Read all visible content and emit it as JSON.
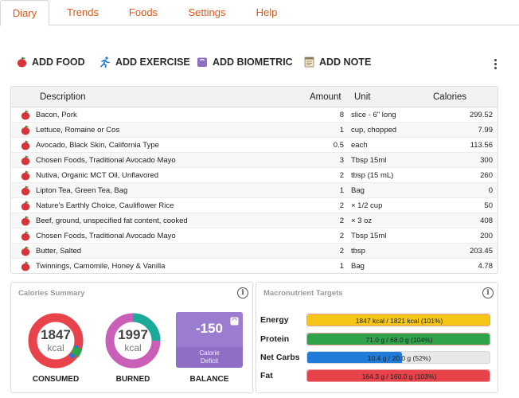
{
  "tabs": [
    {
      "label": "Diary",
      "active": true
    },
    {
      "label": "Trends"
    },
    {
      "label": "Foods"
    },
    {
      "label": "Settings"
    },
    {
      "label": "Help"
    }
  ],
  "actions": {
    "add_food": "ADD FOOD",
    "add_exercise": "ADD EXERCISE",
    "add_biometric": "ADD BIOMETRIC",
    "add_note": "ADD NOTE"
  },
  "table": {
    "headers": {
      "description": "Description",
      "amount": "Amount",
      "unit": "Unit",
      "calories": "Calories"
    },
    "rows": [
      {
        "description": "Bacon, Pork",
        "amount": "8",
        "unit": "slice - 6\" long",
        "calories": "299.52"
      },
      {
        "description": "Lettuce, Romaine or Cos",
        "amount": "1",
        "unit": "cup, chopped",
        "calories": "7.99"
      },
      {
        "description": "Avocado, Black Skin, California Type",
        "amount": "0.5",
        "unit": "each",
        "calories": "113.56"
      },
      {
        "description": "Chosen Foods, Traditional Avocado Mayo",
        "amount": "3",
        "unit": "Tbsp 15ml",
        "calories": "300"
      },
      {
        "description": "Nutiva, Organic MCT Oil, Unflavored",
        "amount": "2",
        "unit": "tbsp (15 mL)",
        "calories": "260"
      },
      {
        "description": "Lipton Tea, Green Tea, Bag",
        "amount": "1",
        "unit": "Bag",
        "calories": "0"
      },
      {
        "description": "Nature's Earthly Choice, Cauliflower Rice",
        "amount": "2",
        "unit": "× 1/2 cup",
        "calories": "50"
      },
      {
        "description": "Beef, ground, unspecified fat content, cooked",
        "amount": "2",
        "unit": "× 3 oz",
        "calories": "408"
      },
      {
        "description": "Chosen Foods, Traditional Avocado Mayo",
        "amount": "2",
        "unit": "Tbsp 15ml",
        "calories": "200"
      },
      {
        "description": "Butter, Salted",
        "amount": "2",
        "unit": "tbsp",
        "calories": "203.45"
      },
      {
        "description": "Twinnings, Camomile, Honey & Vanilla",
        "amount": "1",
        "unit": "Bag",
        "calories": "4.78"
      }
    ]
  },
  "calories_summary": {
    "title": "Calories Summary",
    "consumed": {
      "value": "1847",
      "unit": "kcal",
      "label": "CONSUMED"
    },
    "burned": {
      "value": "1997",
      "unit": "kcal",
      "label": "BURNED"
    },
    "balance": {
      "value": "-150",
      "sub1": "Calorie",
      "sub2": "Deficit",
      "label": "BALANCE"
    }
  },
  "macros": {
    "title": "Macronutrient Targets",
    "items": [
      {
        "label": "Energy",
        "text": "1847 kcal / 1821 kcal (101%)",
        "fraction": 1.0,
        "color": "#f5c518",
        "border": "#e89a9a"
      },
      {
        "label": "Protein",
        "text": "71.0 g / 68.0 g (104%)",
        "fraction": 1.0,
        "color": "#2fa34a",
        "border": "#e89a9a"
      },
      {
        "label": "Net Carbs",
        "text": "10.4 g / 20.0 g (52%)",
        "fraction": 0.52,
        "color": "#1f7bd8",
        "border": "#d8d8d8"
      },
      {
        "label": "Fat",
        "text": "164.3 g / 160.0 g (103%)",
        "fraction": 1.0,
        "color": "#e8424a",
        "border": "#e89a9a"
      }
    ]
  },
  "colors": {
    "accent": "#d9581a",
    "consumed_red": "#e8424a",
    "consumed_green": "#2fa34a",
    "consumed_blue": "#1f7bd8",
    "burned_pink": "#c95fb6",
    "burned_teal": "#1aaa9a",
    "balance_purple": "#8f6fc6"
  }
}
